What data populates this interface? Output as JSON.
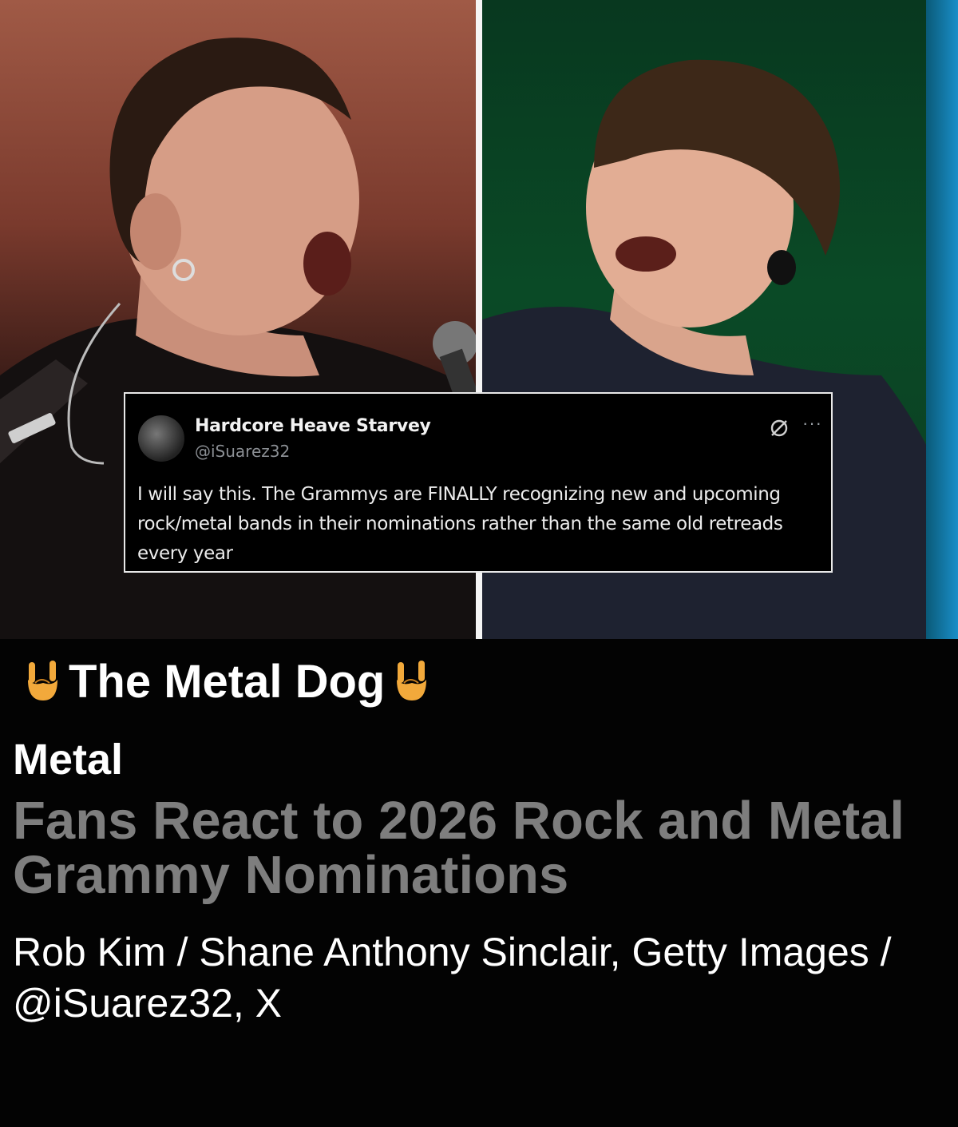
{
  "tweet": {
    "display_name": "Hardcore Heave Starvey",
    "handle": "@iSuarez32",
    "text": "I will say this. The Grammys are FINALLY recognizing new and upcoming rock/metal bands in their nominations rather than the same old retreads every year",
    "more_glyph": "···",
    "icons": [
      "grok-icon",
      "more-options-icon"
    ]
  },
  "brand": {
    "name": "The Metal Dog",
    "icon": "sign-of-the-horns-emoji",
    "icon_color": "#f2a93b"
  },
  "article": {
    "category": "Metal",
    "headline": "Fans React to 2026 Rock and Metal Grammy Nominations",
    "photo_credit": "Rob Kim / Shane Anthony Sinclair, Getty Images / @iSuarez32, X"
  },
  "colors": {
    "background": "#030303",
    "headline": "#7e7e7e",
    "text": "#ffffff"
  }
}
